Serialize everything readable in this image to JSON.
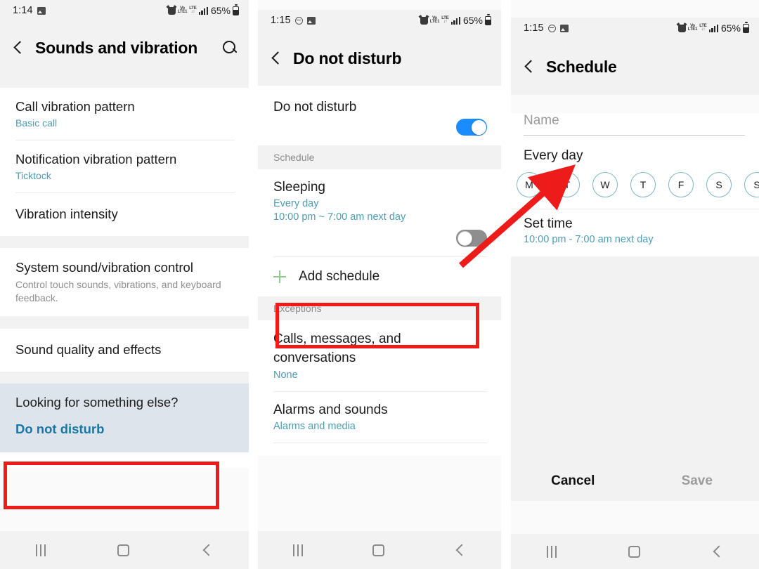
{
  "colors": {
    "accent_teal": "#4e9db1",
    "link_blue": "#1778a6",
    "toggle_on": "#1a8cff",
    "annotation_red": "#ee1b1b",
    "plus_green": "#8fc98f",
    "highlight_bg": "#dde4ec"
  },
  "panel1": {
    "status": {
      "time": "1:14",
      "battery": "65%",
      "icons": [
        "image-icon",
        "alarm-icon",
        "volte-icon",
        "lte-icon",
        "signal-bars-icon",
        "battery-icon"
      ]
    },
    "appbar": {
      "title": "Sounds and vibration",
      "back": "back-chevron-icon",
      "search": "search-icon"
    },
    "rows": [
      {
        "title": "Call vibration pattern",
        "sub": "Basic call"
      },
      {
        "title": "Notification vibration pattern",
        "sub": "Ticktock"
      },
      {
        "title": "Vibration intensity",
        "sub": ""
      }
    ],
    "system_row": {
      "title": "System sound/vibration control",
      "sub": "Control touch sounds, vibrations, and keyboard feedback."
    },
    "sound_quality": {
      "title": "Sound quality and effects"
    },
    "looking": {
      "header": "Looking for something else?",
      "link": "Do not disturb"
    },
    "nav": {
      "recents": "recents-icon",
      "home": "home-icon",
      "back": "back-icon"
    }
  },
  "panel2": {
    "status": {
      "time": "1:15",
      "battery": "65%"
    },
    "appbar": {
      "title": "Do not disturb"
    },
    "dnd_row": {
      "title": "Do not disturb",
      "toggle": "on"
    },
    "schedule_header": "Schedule",
    "sleeping": {
      "title": "Sleeping",
      "sub1": "Every day",
      "sub2": "10:00 pm ~ 7:00 am next day",
      "toggle": "off"
    },
    "add_schedule": {
      "label": "Add schedule",
      "icon": "plus-icon"
    },
    "exceptions_header": "Exceptions",
    "exceptions": [
      {
        "title": "Calls, messages, and conversations",
        "sub": "None"
      },
      {
        "title": "Alarms and sounds",
        "sub": "Alarms and media"
      }
    ]
  },
  "panel3": {
    "status": {
      "time": "1:15",
      "battery": "65%"
    },
    "appbar": {
      "title": "Schedule"
    },
    "name_field": {
      "value": "",
      "placeholder": "Name"
    },
    "every_day_label": "Every day",
    "days": [
      "M",
      "T",
      "W",
      "T",
      "F",
      "S",
      "S"
    ],
    "set_time": {
      "title": "Set time",
      "sub": "10:00 pm - 7:00 am next day"
    },
    "buttons": {
      "cancel": "Cancel",
      "save": "Save"
    }
  }
}
